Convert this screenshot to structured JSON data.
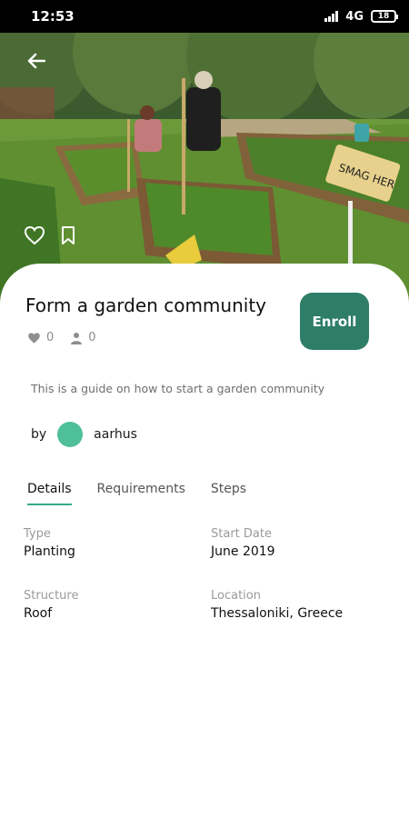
{
  "status_bar": {
    "time": "12:53",
    "network": "4G",
    "battery": "18"
  },
  "hero": {
    "sign_text": "SMAG HER",
    "icons": {
      "back": "arrow-left-icon",
      "like": "heart-outline-icon",
      "bookmark": "bookmark-outline-icon"
    }
  },
  "course": {
    "title": "Form a garden community",
    "likes": "0",
    "enrolled": "0",
    "enroll_label": "Enroll",
    "description": "This is a guide on how to start a garden community"
  },
  "author": {
    "prefix": "by",
    "name": "aarhus",
    "avatar_color": "#4fbf99"
  },
  "tabs": [
    {
      "label": "Details",
      "active": true
    },
    {
      "label": "Requirements",
      "active": false
    },
    {
      "label": "Steps",
      "active": false
    }
  ],
  "details": {
    "type": {
      "label": "Type",
      "value": "Planting"
    },
    "start_date": {
      "label": "Start Date",
      "value": "June 2019"
    },
    "structure": {
      "label": "Structure",
      "value": "Roof"
    },
    "location": {
      "label": "Location",
      "value": "Thessaloniki, Greece"
    }
  },
  "colors": {
    "accent": "#2e7d66",
    "tab_underline": "#3aa78a"
  }
}
